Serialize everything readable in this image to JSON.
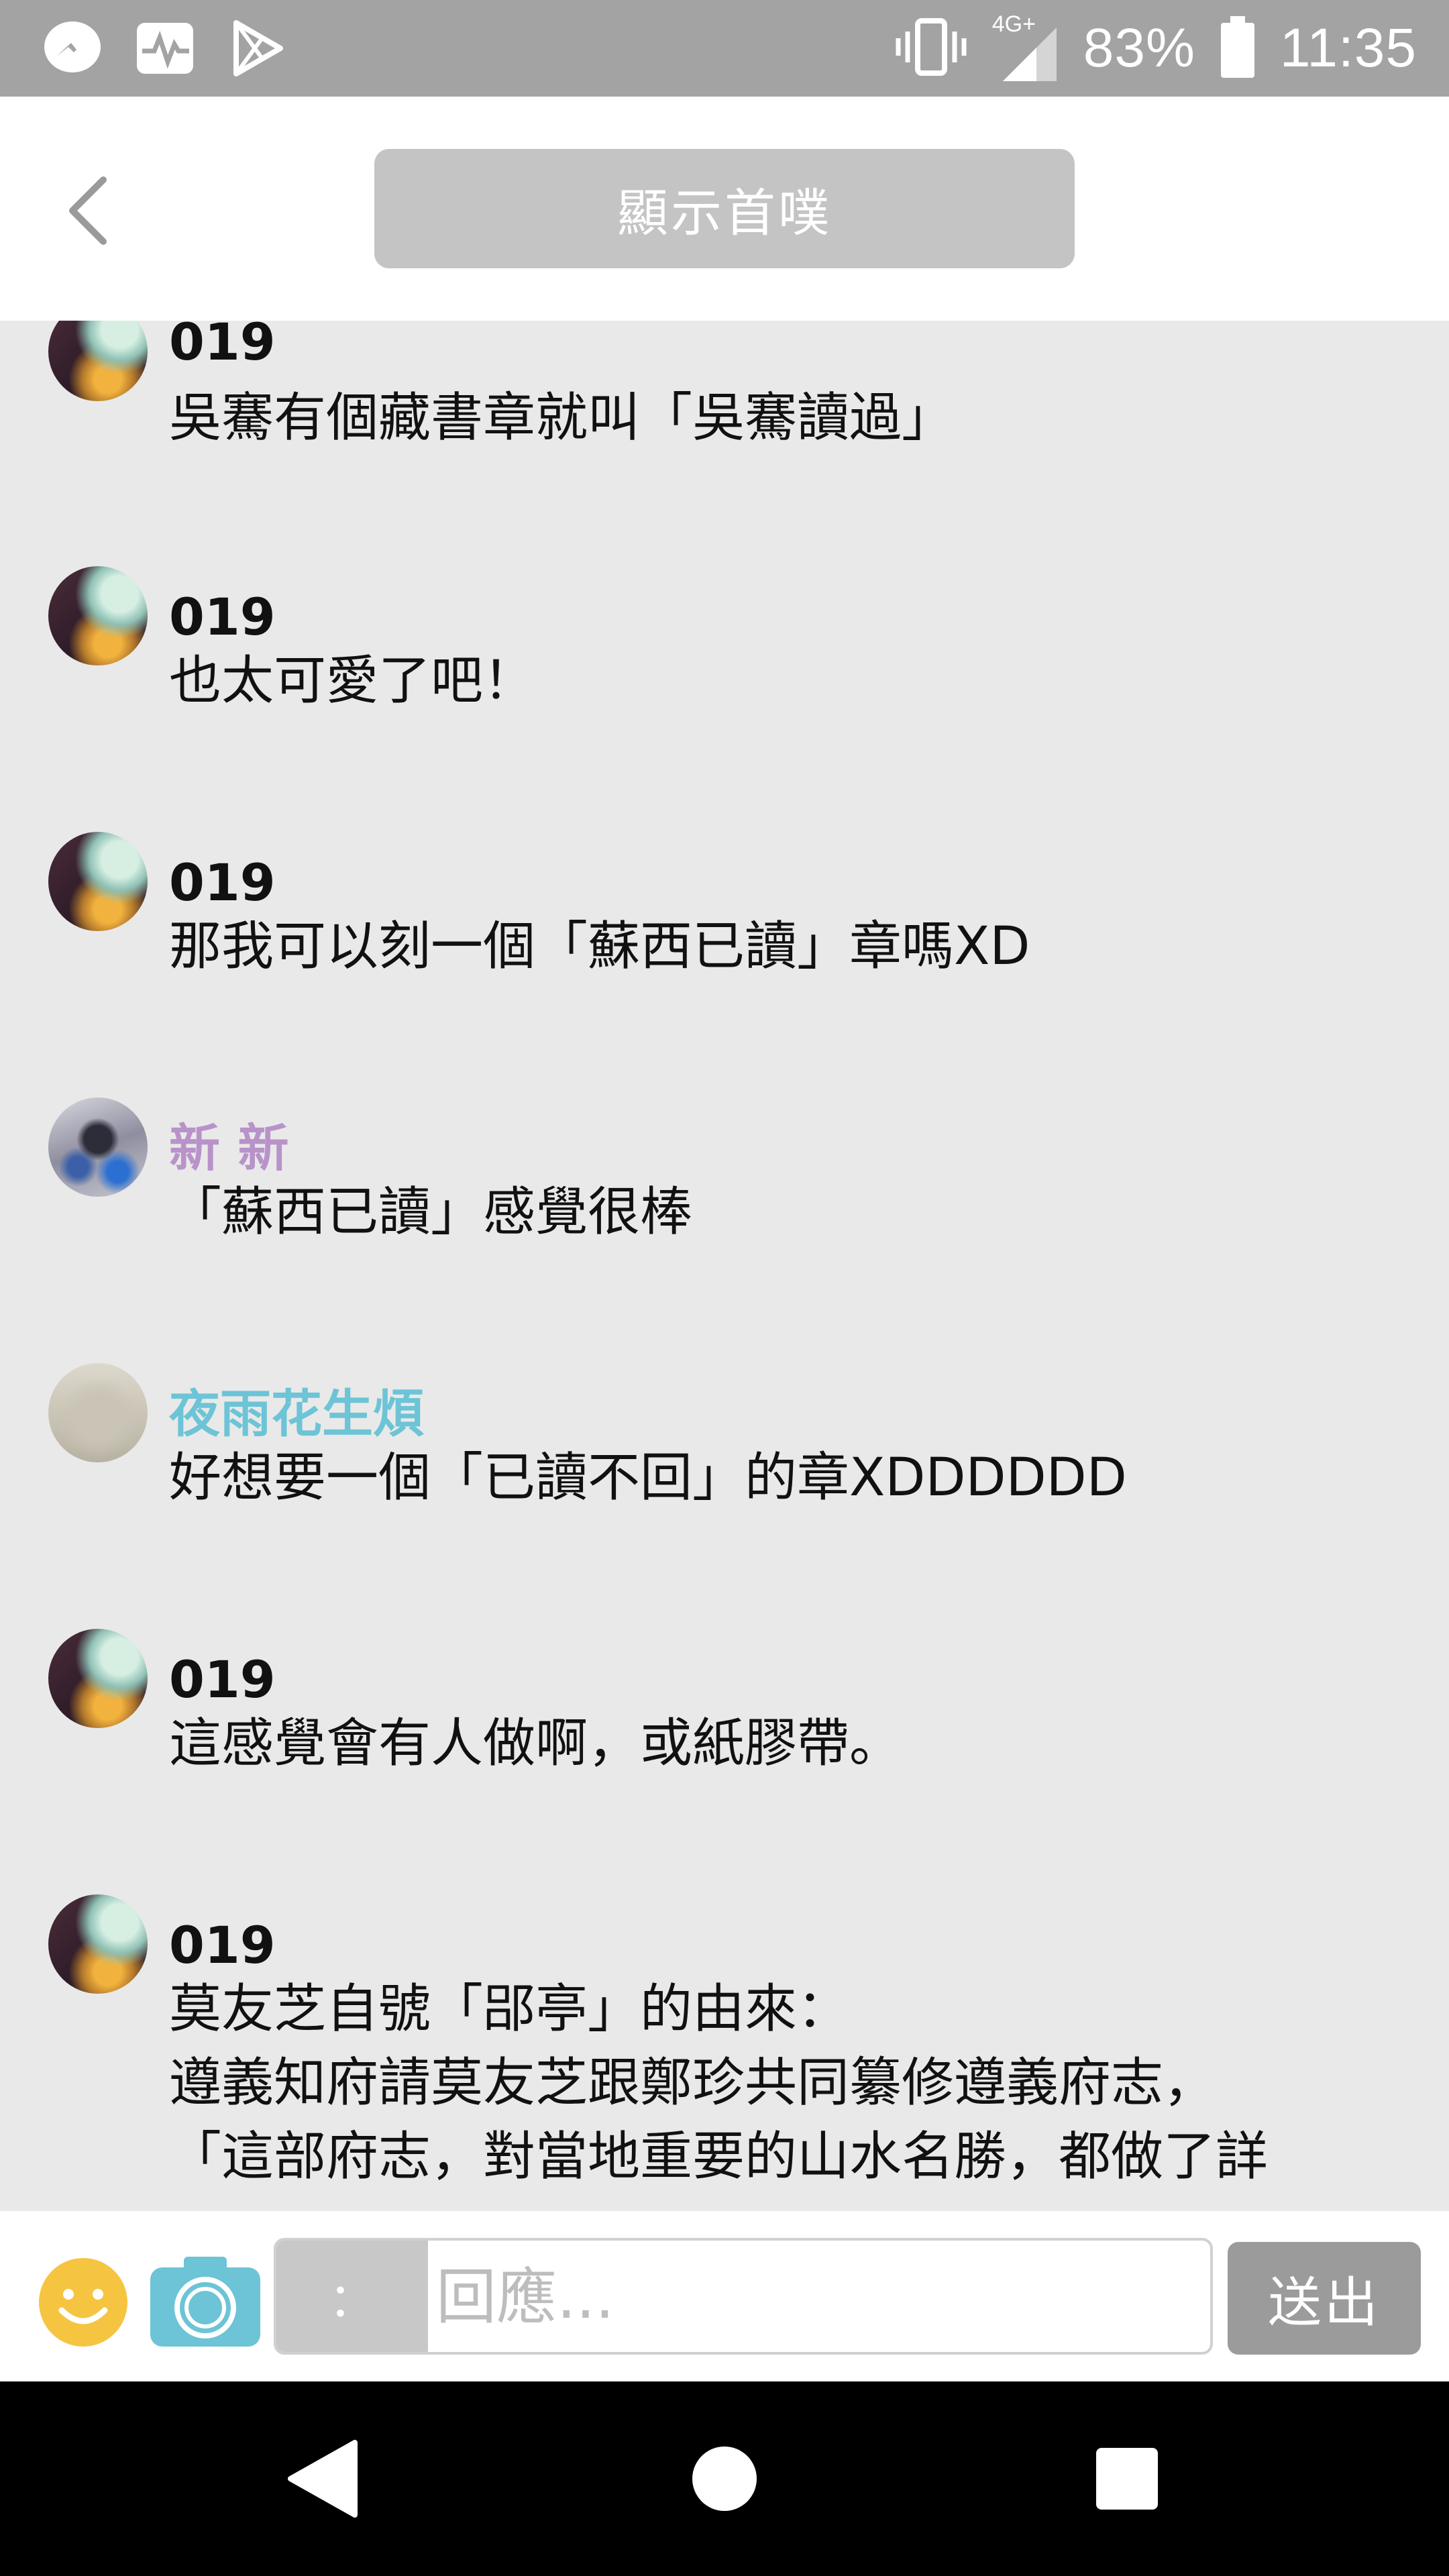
{
  "status_bar": {
    "left_icons": [
      "messenger-icon",
      "activity-icon",
      "play-store-icon"
    ],
    "network_label": "4G+",
    "battery_percent": "83%",
    "time": "11:35"
  },
  "header": {
    "show_first_label": "顯示首噗"
  },
  "messages": [
    {
      "author": "019",
      "text": "吳騫有個藏書章就叫「吳騫讀過」"
    },
    {
      "author": "019",
      "text": "也太可愛了吧！"
    },
    {
      "author": "019",
      "text": "那我可以刻一個「蘇西已讀」章嗎XD"
    },
    {
      "author": "新 新",
      "text": "「蘇西已讀」感覺很棒"
    },
    {
      "author": "夜雨花生煩",
      "text": "好想要一個「已讀不回」的章XDDDDDD"
    },
    {
      "author": "019",
      "text": "這感覺會有人做啊，或紙膠帶。"
    },
    {
      "author": "019",
      "text": "莫友芝自號「郘亭」的由來：\n遵義知府請莫友芝跟鄭珍共同纂修遵義府志，\n「這部府志，對當地重要的山水名勝，都做了詳"
    }
  ],
  "reply_bar": {
    "qualifier": "：",
    "placeholder": "回應...",
    "send_label": "送出"
  },
  "colors": {
    "name_019": "#111111",
    "name_xin": "#b893c9",
    "name_night": "#6cc4d6",
    "camera": "#6cc4d6",
    "emoji": "#f5c542"
  }
}
